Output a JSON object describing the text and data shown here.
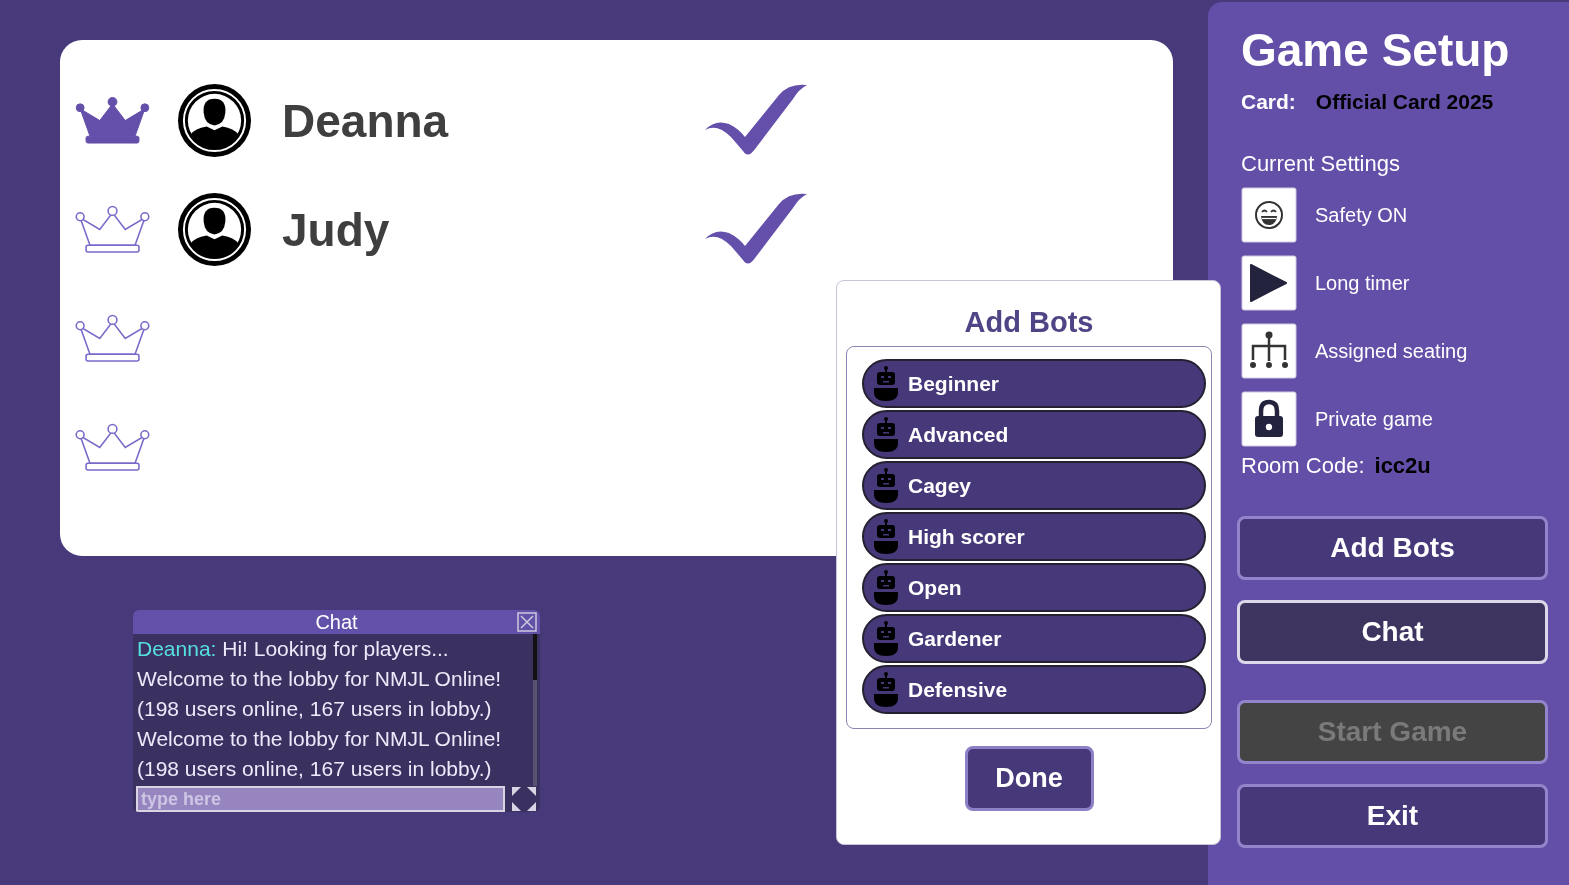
{
  "seats": [
    {
      "host": true,
      "name": "Deanna",
      "ready": true
    },
    {
      "host": false,
      "name": "Judy",
      "ready": true
    },
    {
      "host": false
    },
    {
      "host": false
    }
  ],
  "chat": {
    "title": "Chat",
    "messages": [
      {
        "sender": "Deanna:",
        "text": "Hi! Looking for players..."
      },
      {
        "text": "Welcome to the lobby for NMJL Online!"
      },
      {
        "text": "(198 users online, 167 users in lobby.)"
      },
      {
        "text": "Welcome to the lobby for NMJL Online!"
      },
      {
        "text": "(198 users online, 167 users in lobby.)"
      }
    ],
    "input": {
      "placeholder": "type here"
    }
  },
  "add_bots_dialog": {
    "title": "Add Bots",
    "bots": [
      {
        "label": "Beginner"
      },
      {
        "label": "Advanced"
      },
      {
        "label": "Cagey"
      },
      {
        "label": "High scorer"
      },
      {
        "label": "Open"
      },
      {
        "label": "Gardener"
      },
      {
        "label": "Defensive"
      }
    ],
    "done_button": "Done"
  },
  "game_setup": {
    "title": "Game Setup",
    "card_label": "Card:",
    "card_value": "Official Card 2025",
    "settings_heading": "Current Settings",
    "settings": [
      {
        "label": "Safety ON"
      },
      {
        "label": "Long timer"
      },
      {
        "label": "Assigned seating"
      },
      {
        "label": "Private game"
      }
    ],
    "room_code_label": "Room Code:",
    "room_code": "icc2u",
    "buttons": [
      {
        "label": "Add Bots",
        "selected": false,
        "disabled": false
      },
      {
        "label": "Chat",
        "selected": true,
        "disabled": false
      },
      {
        "label": "Start Game",
        "selected": false,
        "disabled": true
      },
      {
        "label": "Exit",
        "selected": false,
        "disabled": false
      }
    ]
  }
}
